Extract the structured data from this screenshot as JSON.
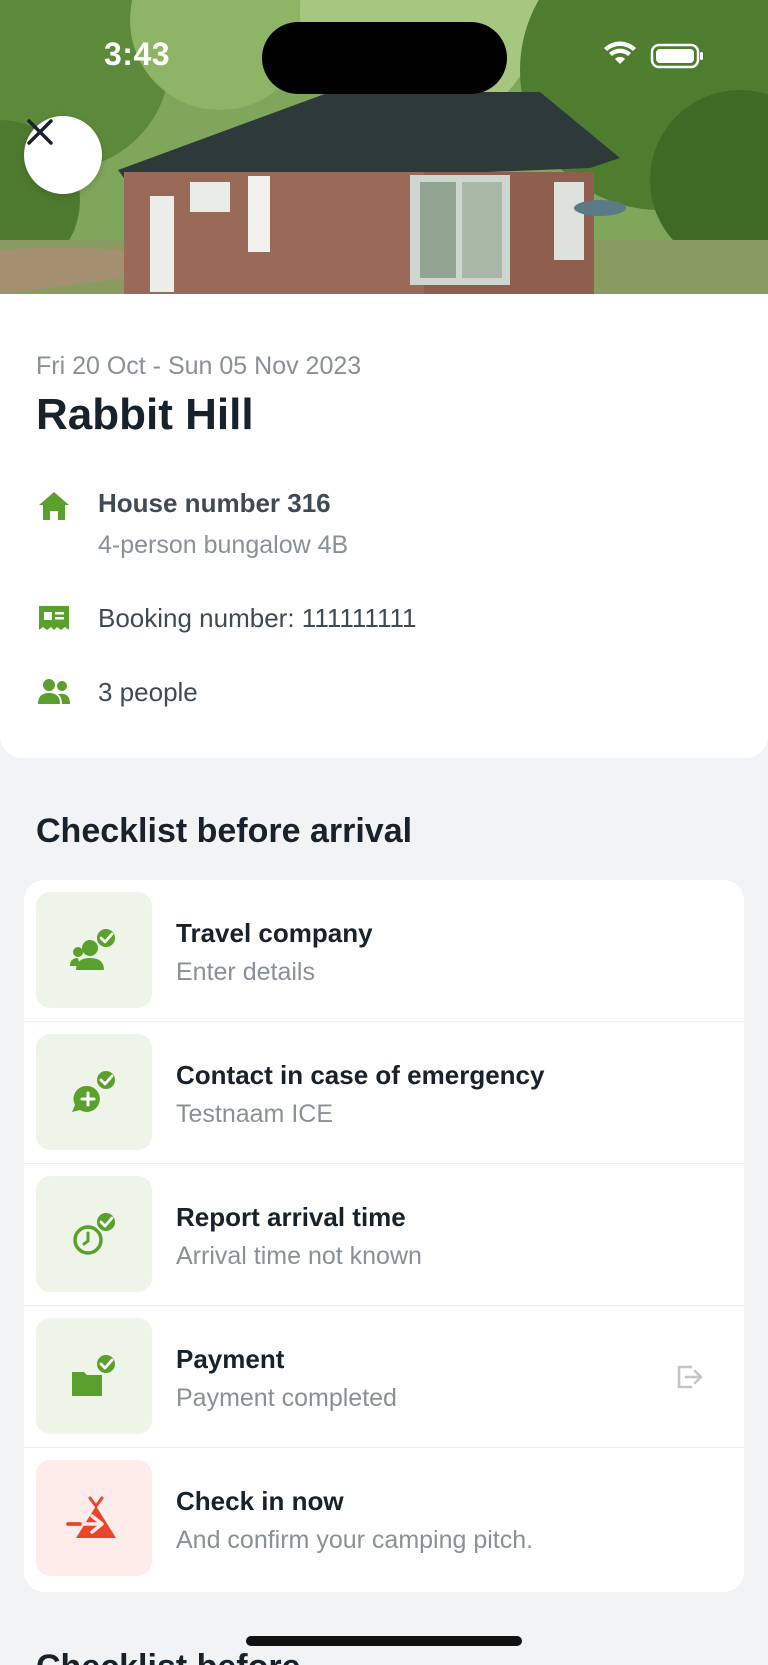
{
  "status_bar": {
    "time": "3:43"
  },
  "booking": {
    "dates": "Fri 20 Oct - Sun 05 Nov 2023",
    "park_name": "Rabbit Hill",
    "house_title": "House number 316",
    "house_type": "4-person bungalow 4B",
    "booking_number": "Booking number: 111111111",
    "people": "3 people"
  },
  "checklist": {
    "title": "Checklist before arrival",
    "items": [
      {
        "title": "Travel company",
        "subtitle": "Enter details",
        "icon": "people-check-icon",
        "status": "done"
      },
      {
        "title": "Contact in case of emergency",
        "subtitle": "Testnaam ICE",
        "icon": "chat-plus-check-icon",
        "status": "done"
      },
      {
        "title": "Report arrival time",
        "subtitle": "Arrival time not known",
        "icon": "clock-check-icon",
        "status": "done"
      },
      {
        "title": "Payment",
        "subtitle": "Payment completed",
        "icon": "wallet-check-icon",
        "status": "done",
        "external": true
      },
      {
        "title": "Check in now",
        "subtitle": "And confirm your camping pitch.",
        "icon": "tent-arrow-icon",
        "status": "action"
      }
    ]
  },
  "next_section": {
    "title": "Checklist before"
  },
  "colors": {
    "accent_green": "#5aa02c",
    "accent_red": "#e8472b",
    "tile_green": "#eef4e8",
    "tile_red": "#fdecea"
  }
}
